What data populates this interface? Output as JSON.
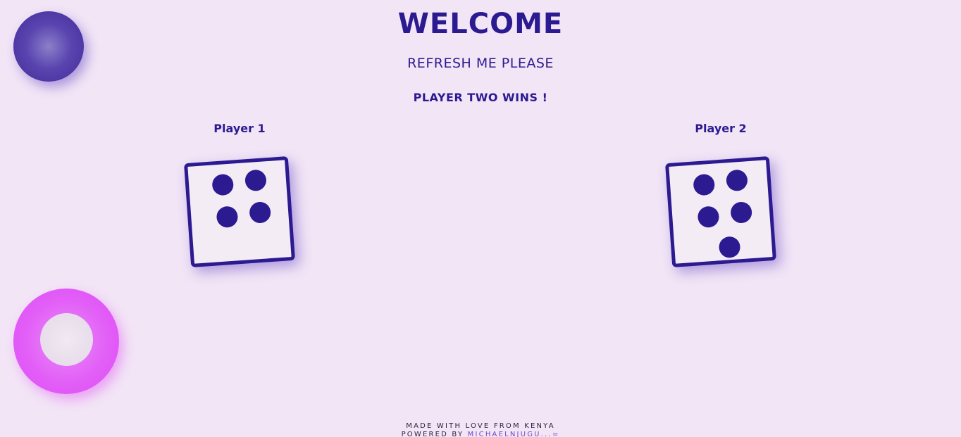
{
  "header": {
    "title": "WELCOME",
    "subtitle": "REFRESH ME PLEASE",
    "result": "PLAYER TWO WINS !"
  },
  "players": [
    {
      "label": "Player 1",
      "die_value": 4
    },
    {
      "label": "Player 2",
      "die_value": 5
    }
  ],
  "footer": {
    "line1": "MADE WITH LOVE FROM KENYA",
    "powered_prefix": "POWERED BY",
    "powered_link": "MICHAELNJUGU...="
  },
  "colors": {
    "background": "#f2e5f6",
    "primary": "#2c1a91",
    "orb": "#5a45b0",
    "ring": "#e25ff7"
  },
  "decorations": {
    "top_left": "purple-orb",
    "bottom_left": "pink-ring"
  }
}
